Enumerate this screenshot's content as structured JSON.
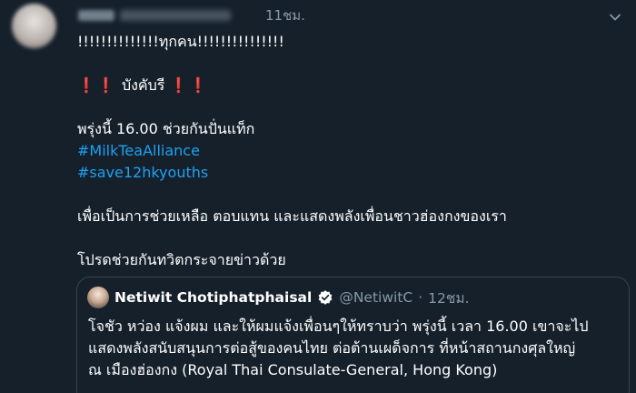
{
  "tweet": {
    "time": "11ชม.",
    "lines": [
      "!!!!!!!!!!!!!!ทุกคน!!!!!!!!!!!!!!!",
      "บังคับรี",
      "พรุ่งนี้ 16.00 ช่วยกันปั่นแท็ก",
      "#MilkTeaAlliance",
      "#save12hkyouths",
      "เพื่อเป็นการช่วยเหลือ ตอบแทน และแสดงพลังเพื่อนชาวฮ่องกงของเรา",
      "โปรดช่วยกันทวิตกระจายข่าวด้วย"
    ],
    "bang_left": "❗❗",
    "bang_right": "❗❗"
  },
  "quote": {
    "name": "Netiwit Chotiphatphaisal",
    "handle": "@NetiwitC",
    "separator": "·",
    "time": "12ชม.",
    "lines": [
      "โจชัว หว่อง แจ้งผม และให้ผมแจ้งเพื่อนๆให้ทราบว่า พรุ่งนี้ เวลา 16.00  เขาจะไป",
      "แสดงพลังสนับสนุนการต่อสู้ของคนไทย ต่อต้านเผด็จการ ที่หน้าสถานกงศุลใหญ่",
      "ณ เมืองฮ่องกง (Royal Thai Consulate-General, Hong Kong)"
    ]
  },
  "colors": {
    "background": "#15202b",
    "link": "#1da1f2",
    "muted": "#8899a6",
    "border": "#38444d",
    "alert": "#e0245e"
  },
  "icons": [
    "chevron-down-icon",
    "verified-badge-icon"
  ]
}
